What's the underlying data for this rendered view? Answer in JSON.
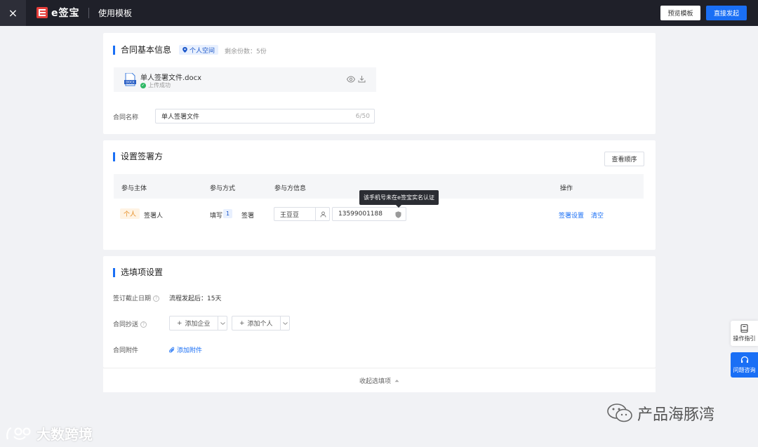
{
  "header": {
    "close": "×",
    "brand": "e签宝",
    "title": "使用模板",
    "preview_button": "预览模板",
    "start_button": "直接发起"
  },
  "contract_info": {
    "title": "合同基本信息",
    "space_badge": "个人空间",
    "remaining": "剩余份数：5份",
    "file": {
      "name": "单人签署文件.docx",
      "status": "上传成功",
      "type_label": "DOCX"
    },
    "name_label": "合同名称",
    "name_value": "单人签署文件",
    "name_count": "6/50"
  },
  "signers": {
    "title": "设置签署方",
    "view_order_button": "查看顺序",
    "columns": [
      "参与主体",
      "参与方式",
      "参与方信息",
      "操作"
    ],
    "row": {
      "entity_tag": "个人",
      "entity_role": "签署人",
      "mode_fill": "填写",
      "mode_order": "1",
      "mode_sign": "签署",
      "name": "王豆豆",
      "phone": "13599001188",
      "tooltip": "该手机号未在e签宝实名认证",
      "action_settings": "签署设置",
      "action_clear": "清空"
    }
  },
  "options": {
    "title": "选填项设置",
    "deadline_label": "签订截止日期",
    "deadline_value": "流程发起后：15天",
    "cc_label": "合同抄送",
    "add_company": "添加企业",
    "add_person": "添加个人",
    "attachment_label": "合同附件",
    "add_attachment": "添加附件",
    "collapse": "收起选填项"
  },
  "side": {
    "guide": "操作指引",
    "help": "问题咨询"
  },
  "watermarks": {
    "left": "大数跨境",
    "right": "产品海豚湾"
  },
  "colors": {
    "accent": "#1a6ff5",
    "header_bg": "#1f2029",
    "success": "#2fb865",
    "tag_orange": "#e58a1f"
  }
}
